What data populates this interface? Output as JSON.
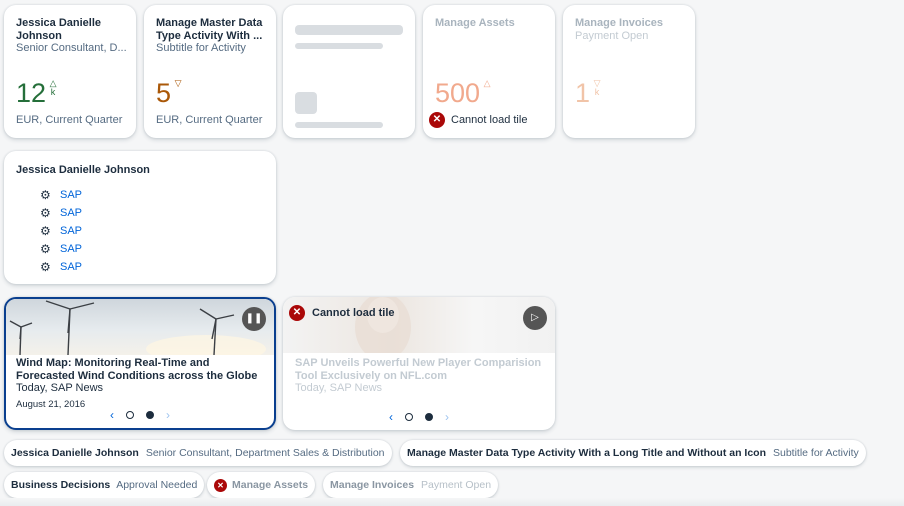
{
  "tiles": {
    "profile_kpi": {
      "title": "Jessica Danielle Johnson",
      "subtitle": "Senior Consultant, D...",
      "value": "12",
      "scale": "k",
      "trend": "up",
      "footer": "EUR, Current Quarter",
      "value_color": "#256f3a"
    },
    "master_data_kpi": {
      "title": "Manage Master Data Type Activity With ...",
      "subtitle": "Subtitle for Activity",
      "value": "5",
      "trend": "down",
      "footer": "EUR, Current Quarter",
      "value_color": "#aa5808"
    },
    "loading_tile": {
      "state": "loading"
    },
    "assets": {
      "title": "Manage Assets",
      "value": "500",
      "trend": "up",
      "error": "Cannot load tile",
      "value_color": "#f1a98d"
    },
    "invoices": {
      "title": "Manage Invoices",
      "subtitle": "Payment Open",
      "value": "1",
      "scale": "k",
      "trend": "down",
      "value_color": "#f1c4a8"
    }
  },
  "link_list": {
    "title": "Jessica Danielle Johnson",
    "icon": "gear-icon",
    "links": [
      "SAP",
      "SAP",
      "SAP",
      "SAP",
      "SAP"
    ]
  },
  "news1": {
    "title": "Wind Map: Monitoring Real-Time and Forecasted Wind Conditions across the Globe",
    "source": "Today, SAP News",
    "date": "August 21, 2016",
    "control": "pause"
  },
  "news2": {
    "error": "Cannot load tile",
    "title": "SAP Unveils Powerful New Player Comparision Tool Exclusively on NFL.com",
    "source": "Today, SAP News",
    "control": "play"
  },
  "chips": [
    {
      "title": "Jessica Danielle Johnson",
      "subtitle": "Senior Consultant, Department Sales & Distribution"
    },
    {
      "title": "Manage Master Data Type Activity With a Long Title and Without an Icon",
      "subtitle": "Subtitle for Activity"
    },
    {
      "title": "Business Decisions",
      "subtitle": "Approval Needed"
    },
    {
      "title": "Manage Assets",
      "subtitle": ""
    },
    {
      "title": "Manage Invoices",
      "subtitle": "Payment Open"
    }
  ],
  "colors": {
    "link": "#0064d9",
    "error": "#aa0808",
    "positive": "#256f3a",
    "critical": "#aa5808",
    "selected_border": "#0a3f8f"
  }
}
